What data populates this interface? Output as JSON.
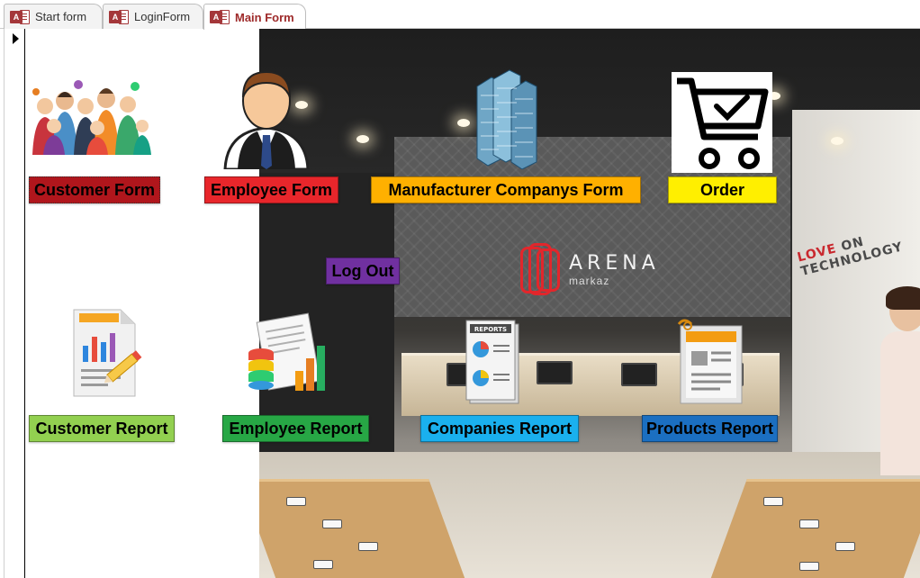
{
  "tabs": [
    {
      "label": "Start form",
      "badge": "A",
      "active": false
    },
    {
      "label": "LoginForm",
      "badge": "A",
      "active": false
    },
    {
      "label": "Main Form",
      "badge": "A",
      "active": true
    }
  ],
  "buttons": {
    "customer_form": "Customer Form",
    "employee_form": "Employee Form",
    "manufacturer_form": "Manufacturer Companys Form",
    "order": "Order",
    "log_out": "Log Out",
    "customer_report": "Customer Report",
    "employee_report": "Employee Report",
    "companies_report": "Companies Report",
    "products_report": "Products Report"
  },
  "icons": {
    "customer_form": "group-of-people-icon",
    "employee_form": "businessman-icon",
    "manufacturer_form": "skyscraper-buildings-icon",
    "order": "shopping-cart-check-icon",
    "customer_report": "document-chart-pencil-icon",
    "employee_report": "report-bar-chart-icon",
    "companies_report": "reports-pie-chart-icon",
    "products_report": "clipboard-document-icon"
  },
  "store": {
    "brand_name": "ARENA",
    "brand_sub": "markaz",
    "slogan_a": "LOVE",
    "slogan_b": " ON TECHNOLOGY"
  },
  "colors": {
    "customer_form": "#b0161c",
    "employee_form": "#e8262b",
    "manufacturer_form": "#ffb000",
    "order": "#ffef00",
    "log_out": "#7030a0",
    "customer_report": "#92d050",
    "employee_report": "#27a745",
    "companies_report": "#1ab0ee",
    "products_report": "#1b6fc1",
    "tab_accent": "#9e2a2a"
  }
}
